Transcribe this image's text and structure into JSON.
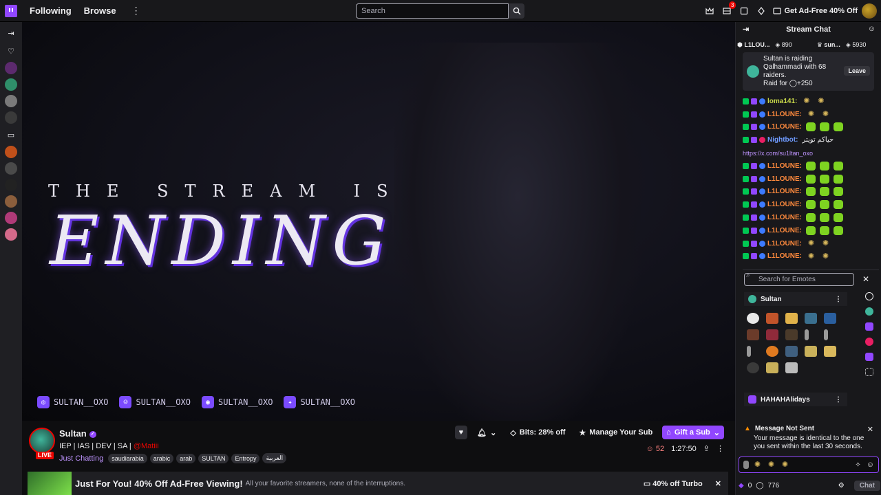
{
  "topbar": {
    "following": "Following",
    "browse": "Browse",
    "more": "⋮",
    "search_placeholder": "Search",
    "notif_count": "3",
    "adfree": "Get Ad-Free 40% Off"
  },
  "stream": {
    "line1": "THE STREAM IS",
    "line2": "ENDING",
    "socials": [
      "SULTAN__OXO",
      "SULTAN__OXO",
      "SULTAN__OXO",
      "SULTAN__OXO"
    ]
  },
  "channel": {
    "name": "Sultan",
    "title_prefix": "IEP | IAS | DEV | SA | ",
    "title_mention": "@Matiii",
    "live": "LIVE",
    "category": "Just Chatting",
    "tags": [
      "saudiarabia",
      "arabic",
      "arab",
      "SULTAN",
      "Entropy",
      "العربية"
    ],
    "bits": "Bits: 28% off",
    "manage_sub": "Manage Your Sub",
    "gift_sub": "Gift a Sub",
    "viewers": "52",
    "uptime": "1:27:50"
  },
  "promo": {
    "title": "Just For You! 40% Off Ad-Free Viewing!",
    "subtitle": "All your favorite streamers, none of the interruptions.",
    "turbo": "40% off Turbo"
  },
  "chat": {
    "header": "Stream Chat",
    "stats_left": "L1LOU...",
    "stats_count": "890",
    "stats_right": "sun...",
    "stats_right_count": "5930",
    "raid": {
      "l1": "Sultan is raiding",
      "l2": "Qalhammadi with 68",
      "l3": "raiders.",
      "l4": "Raid for ◯+250",
      "leave": "Leave"
    },
    "messages": [
      {
        "user": "loma141:",
        "color": "#c9d94a",
        "emotes": "ss"
      },
      {
        "user": "L1LOUNE:",
        "color": "#ff8a3d",
        "emotes": "ss"
      },
      {
        "user": "L1LOUNE:",
        "color": "#ff8a3d",
        "emotes": "ggg"
      },
      {
        "user": "Nightbot:",
        "color": "#6f9bff",
        "text": "حياكم تويتر"
      },
      {
        "user": "L1LOUNE:",
        "color": "#ff8a3d",
        "emotes": "ggg"
      },
      {
        "user": "L1LOUNE:",
        "color": "#ff8a3d",
        "emotes": "ggg"
      },
      {
        "user": "L1LOUNE:",
        "color": "#ff8a3d",
        "emotes": "ggg"
      },
      {
        "user": "L1LOUNE:",
        "color": "#ff8a3d",
        "emotes": "ggg"
      },
      {
        "user": "L1LOUNE:",
        "color": "#ff8a3d",
        "emotes": "ggg"
      },
      {
        "user": "L1LOUNE:",
        "color": "#ff8a3d",
        "emotes": "ggg"
      },
      {
        "user": "L1LOUNE:",
        "color": "#ff8a3d",
        "emotes": "ss"
      },
      {
        "user": "L1LOUNE:",
        "color": "#ff8a3d",
        "emotes": "ss"
      }
    ],
    "nightbot_link": "https://x.com/su1ltan_oxo",
    "emote_search_placeholder": "Search for Emotes",
    "emote_section_1": "Sultan",
    "emote_section_2": "HAHAHAlidays",
    "notice_title": "Message Not Sent",
    "notice_body": "Your message is identical to the one you sent within the last 30 seconds.",
    "points": "0",
    "points2": "776",
    "chat_button": "Chat"
  }
}
